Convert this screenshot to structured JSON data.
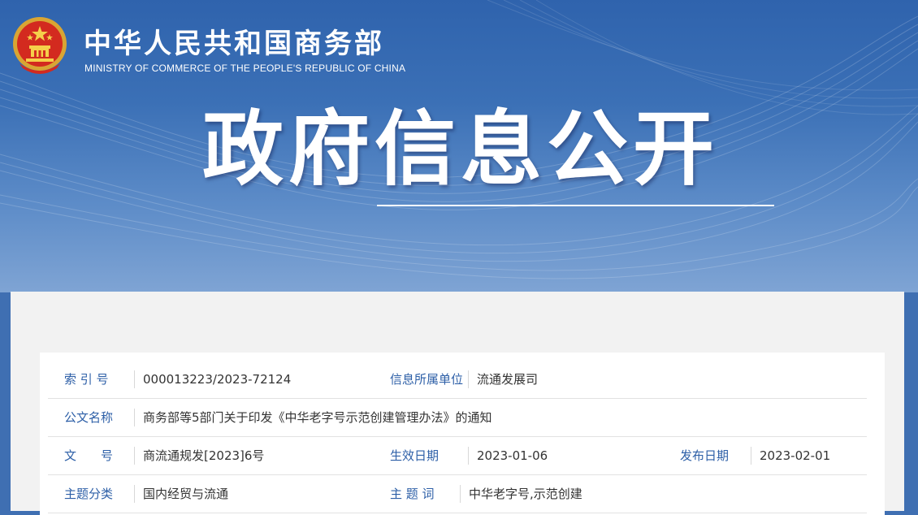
{
  "header": {
    "ministry_cn": "中华人民共和国商务部",
    "ministry_en": "MINISTRY OF COMMERCE OF THE PEOPLE'S REPUBLIC OF CHINA",
    "emblem_icon": "national-emblem-icon",
    "banner_title": "政府信息公开"
  },
  "colors": {
    "banner_blue": "#3b70b6",
    "label_blue": "#2d5fa7",
    "value_text": "#333333",
    "panel_bg": "#f2f2f2"
  },
  "info": {
    "index_label": "索 引 号",
    "index_value": "000013223/2023-72124",
    "unit_label": "信息所属单位",
    "unit_value": "流通发展司",
    "doc_name_label": "公文名称",
    "doc_name_value": "商务部等5部门关于印发《中华老字号示范创建管理办法》的通知",
    "doc_no_label": "文　　号",
    "doc_no_value": "商流通规发[2023]6号",
    "effective_label": "生效日期",
    "effective_value": "2023-01-06",
    "publish_label": "发布日期",
    "publish_value": "2023-02-01",
    "category_label": "主题分类",
    "category_value": "国内经贸与流通",
    "keywords_label": "主 题 词",
    "keywords_value": "中华老字号,示范创建"
  }
}
